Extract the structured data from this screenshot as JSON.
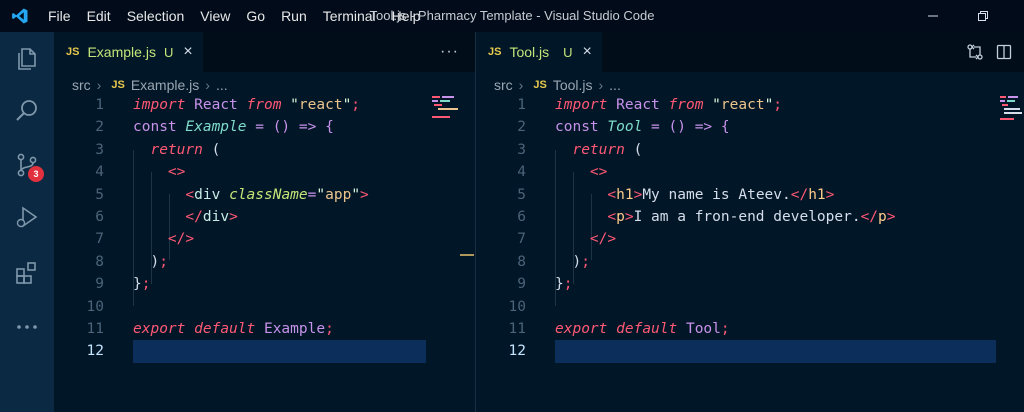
{
  "titlebar": {
    "menu": [
      "File",
      "Edit",
      "Selection",
      "View",
      "Go",
      "Run",
      "Terminal",
      "Help"
    ],
    "title": "Tool.js - Pharmacy Template - Visual Studio Code",
    "logo_icon": "vscode-logo-icon",
    "controls": [
      "minimize-icon",
      "restore-icon"
    ]
  },
  "activitybar": {
    "items": [
      "explorer-icon",
      "search-icon",
      "source-control-icon",
      "run-debug-icon",
      "extensions-icon",
      "more-icon"
    ],
    "scm_badge": "3"
  },
  "left_editor": {
    "tab": {
      "lang": "JS",
      "name": "Example.js",
      "status": "U",
      "close": "×"
    },
    "more_actions": "···",
    "breadcrumb": {
      "folder": "src",
      "lang": "JS",
      "file": "Example.js",
      "rest": "..."
    },
    "line_numbers": [
      "1",
      "2",
      "3",
      "4",
      "5",
      "6",
      "7",
      "8",
      "9",
      "10",
      "11",
      "12"
    ],
    "code": {
      "l1": {
        "import": "import",
        "react": "React",
        "from": "from",
        "q1": "\"",
        "mod": "react",
        "q2": "\"",
        "semi": ";"
      },
      "l2": {
        "const": "const",
        "name": "Example",
        "eq": "=",
        "arrow": "() => {"
      },
      "l3": {
        "ret": "return",
        "paren": "("
      },
      "l4": {
        "frag": "<>"
      },
      "l5": {
        "open": "<",
        "tag": "div",
        "attr": "className",
        "eq": "=",
        "q1": "\"",
        "val": "app",
        "q2": "\"",
        "close": ">"
      },
      "l6": {
        "close": "</",
        "tag": "div",
        "end": ">"
      },
      "l7": {
        "frag": "</>"
      },
      "l8": {
        "paren": ")",
        "semi": ";"
      },
      "l9": {
        "brace": "}",
        "semi": ";"
      },
      "l11": {
        "export": "export",
        "def": "default",
        "name": "Example",
        "semi": ";"
      }
    }
  },
  "right_editor": {
    "tab": {
      "lang": "JS",
      "name": "Tool.js",
      "status": "U",
      "close": "×"
    },
    "actions": [
      "compare-changes-icon",
      "split-editor-icon"
    ],
    "breadcrumb": {
      "folder": "src",
      "lang": "JS",
      "file": "Tool.js",
      "rest": "..."
    },
    "line_numbers": [
      "1",
      "2",
      "3",
      "4",
      "5",
      "6",
      "7",
      "8",
      "9",
      "10",
      "11",
      "12"
    ],
    "code": {
      "l1": {
        "import": "import",
        "react": "React",
        "from": "from",
        "q1": "\"",
        "mod": "react",
        "q2": "\"",
        "semi": ";"
      },
      "l2": {
        "const": "const",
        "name": "Tool",
        "eq": "=",
        "arrow": "() => {"
      },
      "l3": {
        "ret": "return",
        "paren": "("
      },
      "l4": {
        "frag": "<>"
      },
      "l5": {
        "open": "<",
        "tag": "h1",
        "close": ">",
        "text": "My name is Ateev.",
        "open2": "</",
        "tag2": "h1",
        "close2": ">"
      },
      "l6": {
        "open": "<",
        "tag": "p",
        "close": ">",
        "text": "I am a fron-end developer.",
        "open2": "</",
        "tag2": "p",
        "close2": ">"
      },
      "l7": {
        "frag": "</>"
      },
      "l8": {
        "paren": ")",
        "semi": ";"
      },
      "l9": {
        "brace": "}",
        "semi": ";"
      },
      "l11": {
        "export": "export",
        "def": "default",
        "name": "Tool",
        "semi": ";"
      }
    }
  },
  "active_line": "12",
  "colors": {
    "background": "#011627",
    "activity_bar": "#0b2942",
    "keyword_italic": "#ff5874",
    "keyword": "#c792ea",
    "string": "#ecc48d",
    "function": "#7fdbca",
    "current_line": "#0b2f5a"
  }
}
